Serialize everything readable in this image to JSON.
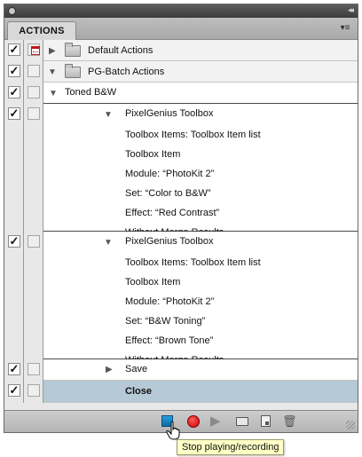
{
  "panel": {
    "tab_label": "ACTIONS",
    "panel_menu_icon": "panel-menu-icon",
    "collapse_icon": "double-chevron-icon"
  },
  "rows": {
    "default_actions": {
      "label": "Default Actions",
      "checked": true,
      "dialog_toggle": true,
      "expanded": false
    },
    "pg_batch": {
      "label": "PG-Batch Actions",
      "checked": true,
      "dialog_toggle": false,
      "expanded": true
    },
    "toned_bw": {
      "label": "Toned B&W",
      "checked": true,
      "expanded": true
    },
    "toolbox1": {
      "label": "PixelGenius Toolbox",
      "checked": true,
      "params": [
        "Toolbox Items: Toolbox Item list",
        "Toolbox Item",
        "Module:  “PhotoKit 2”",
        "Set:  “Color to B&W”",
        "Effect:  “Red Contrast”",
        "Without Merge Results"
      ]
    },
    "toolbox2": {
      "label": "PixelGenius Toolbox",
      "checked": true,
      "params": [
        "Toolbox Items: Toolbox Item list",
        "Toolbox Item",
        "Module:  “PhotoKit 2”",
        "Set:  “B&W Toning”",
        "Effect:  “Brown Tone”",
        "Without Merge Results"
      ]
    },
    "save": {
      "label": "Save",
      "checked": true
    },
    "close": {
      "label": "Close",
      "checked": true,
      "selected": true
    }
  },
  "footer": {
    "buttons": [
      "stop-icon",
      "record-icon",
      "play-icon",
      "new-set-icon",
      "new-action-icon",
      "trash-icon"
    ]
  },
  "tooltip": {
    "text": "Stop playing/recording"
  },
  "colors": {
    "selected_row": "#b6c9d6",
    "record_red": "#d40000",
    "stop_blue": "#1a86c8",
    "tooltip_bg": "#ffffc6"
  }
}
